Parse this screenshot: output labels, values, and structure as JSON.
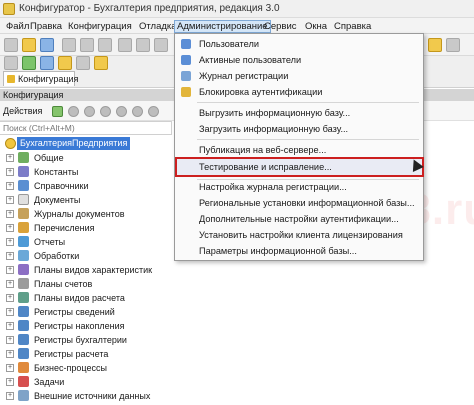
{
  "window": {
    "title": "Конфигуратор - Бухгалтерия предприятия, редакция 3.0"
  },
  "menubar": {
    "items": [
      "Файл",
      "Правка",
      "Конфигурация",
      "Отладка",
      "Администрирование",
      "Сервис",
      "Окна",
      "Справка"
    ],
    "active": "Администрирование"
  },
  "tabs": {
    "configuration": "Конфигурация"
  },
  "panel": {
    "header": "Конфигурация",
    "actions_label": "Действия",
    "search_placeholder": "Поиск (Ctrl+Alt+M)"
  },
  "tree": {
    "root": "БухгалтерияПредприятия",
    "items": [
      "Общие",
      "Константы",
      "Справочники",
      "Документы",
      "Журналы документов",
      "Перечисления",
      "Отчеты",
      "Обработки",
      "Планы видов характеристик",
      "Планы счетов",
      "Планы видов расчета",
      "Регистры сведений",
      "Регистры накопления",
      "Регистры бухгалтерии",
      "Регистры расчета",
      "Бизнес-процессы",
      "Задачи",
      "Внешние источники данных"
    ]
  },
  "admin_menu": {
    "items": [
      "Пользователи",
      "Активные пользователи",
      "Журнал регистрации",
      "Блокировка аутентификации",
      "Выгрузить информационную базу...",
      "Загрузить информационную базу...",
      "Публикация на веб-сервере...",
      "Тестирование и исправление...",
      "Настройка журнала регистрации...",
      "Региональные установки информационной базы...",
      "Дополнительные настройки аутентификации...",
      "Установить настройки клиента лицензирования",
      "Параметры информационной базы..."
    ],
    "highlighted": "Тестирование и исправление..."
  },
  "watermark": {
    "text": "ПРОФБУХ8.ru"
  },
  "colors": {
    "accent": "#3a7ad6",
    "highlight_border": "#cc1f1f",
    "menu_active_bg": "#d5e6f8"
  }
}
